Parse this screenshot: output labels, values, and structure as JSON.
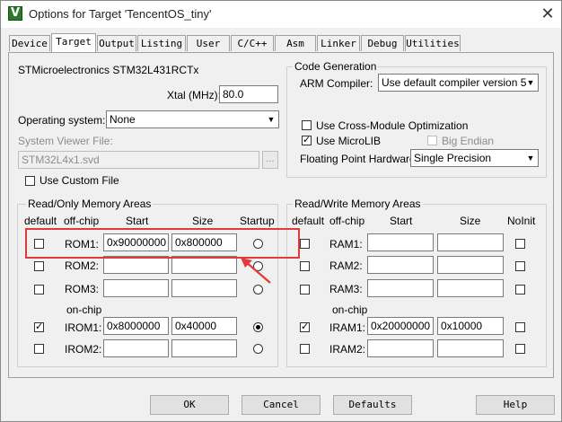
{
  "window": {
    "title": "Options for Target 'TencentOS_tiny'",
    "app_icon": "uvision-icon",
    "close_icon": "close-icon"
  },
  "tabs": [
    "Device",
    "Target",
    "Output",
    "Listing",
    "User",
    "C/C++",
    "Asm",
    "Linker",
    "Debug",
    "Utilities"
  ],
  "active_tab": "Target",
  "device": {
    "name": "STMicroelectronics STM32L431RCTx"
  },
  "xtal": {
    "label": "Xtal (MHz):",
    "value": "80.0"
  },
  "os": {
    "label": "Operating system:",
    "value": "None"
  },
  "svd": {
    "label": "System Viewer File:",
    "value": "STM32L4x1.svd",
    "browse": "...",
    "custom_label": "Use Custom File",
    "custom_checked": false
  },
  "codegen": {
    "title": "Code Generation",
    "compiler_label": "ARM Compiler:",
    "compiler_value": "Use default compiler version 5",
    "cross_module_label": "Use Cross-Module Optimization",
    "cross_module_checked": false,
    "microlib_label": "Use MicroLIB",
    "microlib_checked": true,
    "big_endian_label": "Big Endian",
    "big_endian_checked": false,
    "fpu_label": "Floating Point Hardware:",
    "fpu_value": "Single Precision"
  },
  "rom": {
    "title": "Read/Only Memory Areas",
    "headers": {
      "default": "default",
      "offchip": "off-chip",
      "start": "Start",
      "size": "Size",
      "startup": "Startup"
    },
    "onchip_label": "on-chip",
    "rows": [
      {
        "label": "ROM1:",
        "start": "0x90000000",
        "size": "0x800000",
        "default": false,
        "startup": false
      },
      {
        "label": "ROM2:",
        "start": "",
        "size": "",
        "default": false,
        "startup": false
      },
      {
        "label": "ROM3:",
        "start": "",
        "size": "",
        "default": false,
        "startup": false
      },
      {
        "label": "IROM1:",
        "start": "0x8000000",
        "size": "0x40000",
        "default": true,
        "startup": true
      },
      {
        "label": "IROM2:",
        "start": "",
        "size": "",
        "default": false,
        "startup": false
      }
    ]
  },
  "ram": {
    "title": "Read/Write Memory Areas",
    "headers": {
      "default": "default",
      "offchip": "off-chip",
      "start": "Start",
      "size": "Size",
      "noinit": "NoInit"
    },
    "onchip_label": "on-chip",
    "rows": [
      {
        "label": "RAM1:",
        "start": "",
        "size": "",
        "default": false,
        "noinit": false
      },
      {
        "label": "RAM2:",
        "start": "",
        "size": "",
        "default": false,
        "noinit": false
      },
      {
        "label": "RAM3:",
        "start": "",
        "size": "",
        "default": false,
        "noinit": false
      },
      {
        "label": "IRAM1:",
        "start": "0x20000000",
        "size": "0x10000",
        "default": true,
        "noinit": false
      },
      {
        "label": "IRAM2:",
        "start": "",
        "size": "",
        "default": false,
        "noinit": false
      }
    ]
  },
  "buttons": {
    "ok": "OK",
    "cancel": "Cancel",
    "defaults": "Defaults",
    "help": "Help"
  },
  "annotation_color": "#e03a3a"
}
